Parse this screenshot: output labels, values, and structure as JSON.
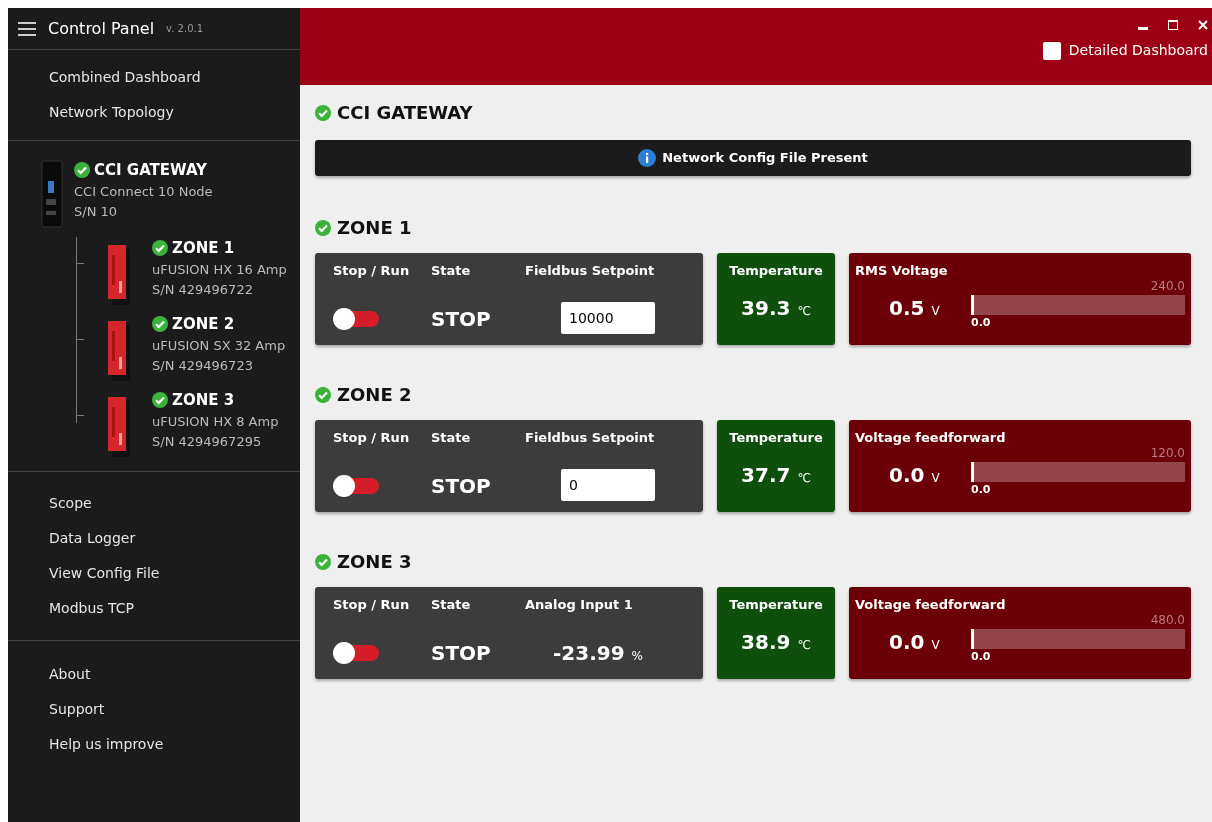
{
  "sidebar": {
    "title": "Control Panel",
    "version": "v. 2.0.1",
    "nav": [
      {
        "label": "Combined Dashboard",
        "selected": false
      },
      {
        "label": "Network Topology",
        "selected": false
      }
    ],
    "devices": [
      {
        "kind": "gateway",
        "name": "CCI GATEWAY",
        "ok": true,
        "model": "CCI Connect 10 Node",
        "serial": "S/N 10",
        "children": [
          {
            "kind": "zone",
            "name": "ZONE 1",
            "ok": true,
            "model": "uFUSION HX 16 Amp",
            "serial": "S/N 429496722"
          },
          {
            "kind": "zone",
            "name": "ZONE 2",
            "ok": true,
            "model": "uFUSION SX 32 Amp",
            "serial": "S/N 429496723"
          },
          {
            "kind": "zone",
            "name": "ZONE 3",
            "ok": true,
            "model": "uFUSION HX 8 Amp",
            "serial": "S/N 4294967295"
          }
        ]
      }
    ],
    "tools": [
      "Scope",
      "Data Logger",
      "View Config File",
      "Modbus TCP"
    ],
    "footer": [
      "About",
      "Support",
      "Help us improve"
    ]
  },
  "header": {
    "detailed_dashboard": {
      "label": "Detailed Dashboard",
      "checked": false
    }
  },
  "gateway": {
    "title": "CCI GATEWAY",
    "ok": true,
    "banner": "Network Config File Present"
  },
  "zones": [
    {
      "title": "ZONE 1",
      "ok": true,
      "stop_run_label": "Stop / Run",
      "running": false,
      "state_label": "State",
      "state": "STOP",
      "input": {
        "kind": "field",
        "label": "Fieldbus Setpoint",
        "value": "10000"
      },
      "temperature": {
        "label": "Temperature",
        "value": "39.3",
        "unit": "℃"
      },
      "voltage": {
        "label": "RMS Voltage",
        "value": "0.5",
        "unit": "V",
        "min": "0.0",
        "max": "240.0",
        "level": 0.002
      }
    },
    {
      "title": "ZONE 2",
      "ok": true,
      "stop_run_label": "Stop / Run",
      "running": false,
      "state_label": "State",
      "state": "STOP",
      "input": {
        "kind": "field",
        "label": "Fieldbus Setpoint",
        "value": "0"
      },
      "temperature": {
        "label": "Temperature",
        "value": "37.7",
        "unit": "℃"
      },
      "voltage": {
        "label": "Voltage feedforward",
        "value": "0.0",
        "unit": "V",
        "min": "0.0",
        "max": "120.0",
        "level": 0
      }
    },
    {
      "title": "ZONE 3",
      "ok": true,
      "stop_run_label": "Stop / Run",
      "running": false,
      "state_label": "State",
      "state": "STOP",
      "input": {
        "kind": "reading",
        "label": "Analog Input 1",
        "value": "-23.99",
        "unit": "%"
      },
      "temperature": {
        "label": "Temperature",
        "value": "38.9",
        "unit": "℃"
      },
      "voltage": {
        "label": "Voltage feedforward",
        "value": "0.0",
        "unit": "V",
        "min": "0.0",
        "max": "480.0",
        "level": 0
      }
    }
  ]
}
